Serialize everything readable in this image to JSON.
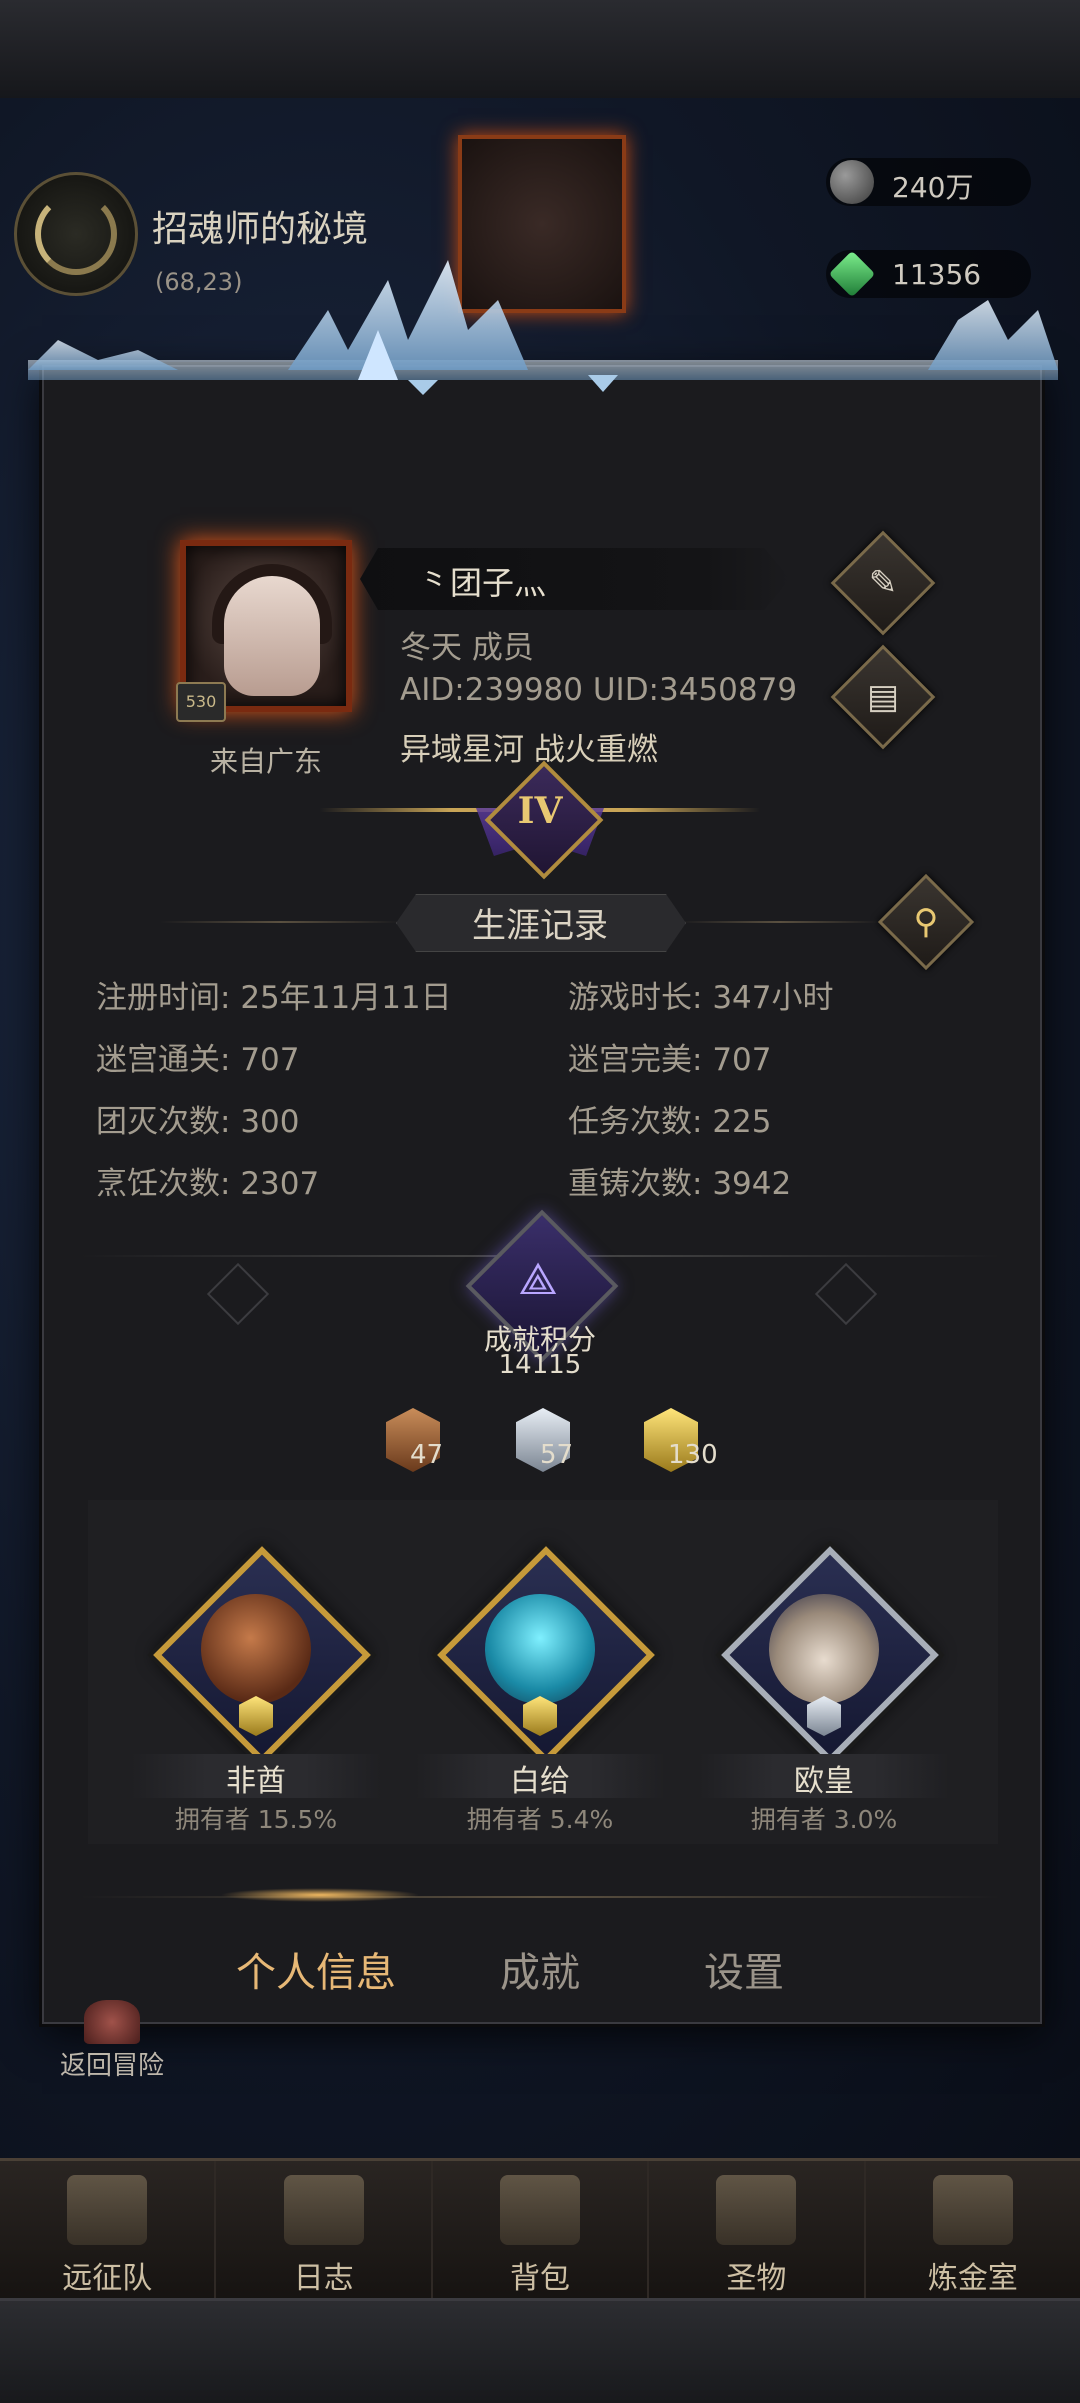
{
  "location": {
    "name": "招魂师的秘境",
    "coords": "(68,23)"
  },
  "resources": [
    {
      "icon": "stone-icon",
      "value": "240万"
    },
    {
      "icon": "green-gem-icon",
      "value": "11356"
    }
  ],
  "profile": {
    "avatar_level": "530",
    "name": "⺀团子灬",
    "guild_line": "冬天  成员",
    "ids_line": "AID:239980 UID:3450879",
    "server_line": "异域星河  战火重燃",
    "from": "来自广东",
    "rank": "IV"
  },
  "career": {
    "title": "生涯记录",
    "stats": [
      {
        "label": "注册时间:",
        "value": "25年11月11日"
      },
      {
        "label": "游戏时长:",
        "value": "347小时"
      },
      {
        "label": "迷宫通关:",
        "value": "707"
      },
      {
        "label": "迷宫完美:",
        "value": "707"
      },
      {
        "label": "团灭次数:",
        "value": "300"
      },
      {
        "label": "任务次数:",
        "value": "225"
      },
      {
        "label": "烹饪次数:",
        "value": "2307"
      },
      {
        "label": "重铸次数:",
        "value": "3942"
      }
    ]
  },
  "achievements": {
    "label": "成就积分",
    "score": "14115",
    "medals": [
      {
        "tier": "bronze",
        "count": "47"
      },
      {
        "tier": "silver",
        "count": "57"
      },
      {
        "tier": "gold",
        "count": "130"
      }
    ],
    "cards": [
      {
        "name": "非酋",
        "owner": "拥有者 15.5%",
        "frame": "gold",
        "art": "tribal-warrior-icon"
      },
      {
        "name": "白给",
        "owner": "拥有者 5.4%",
        "frame": "gold",
        "art": "ghost-icon"
      },
      {
        "name": "欧皇",
        "owner": "拥有者 3.0%",
        "frame": "silver",
        "art": "crowned-king-icon"
      }
    ]
  },
  "tabs": [
    {
      "label": "个人信息",
      "active": true
    },
    {
      "label": "成就",
      "active": false
    },
    {
      "label": "设置",
      "active": false
    }
  ],
  "back_label": "返回冒险",
  "nav": [
    {
      "label": "远征队",
      "icon": "helmet-icon"
    },
    {
      "label": "日志",
      "icon": "scroll-icon"
    },
    {
      "label": "背包",
      "icon": "bag-icon"
    },
    {
      "label": "圣物",
      "icon": "chalice-icon"
    },
    {
      "label": "炼金室",
      "icon": "alchemy-icon"
    }
  ],
  "colors": {
    "gold": "#c69a3a",
    "silver": "#a8aeb8",
    "bronze": "#a0643a",
    "active_tab": "#e7b876"
  }
}
